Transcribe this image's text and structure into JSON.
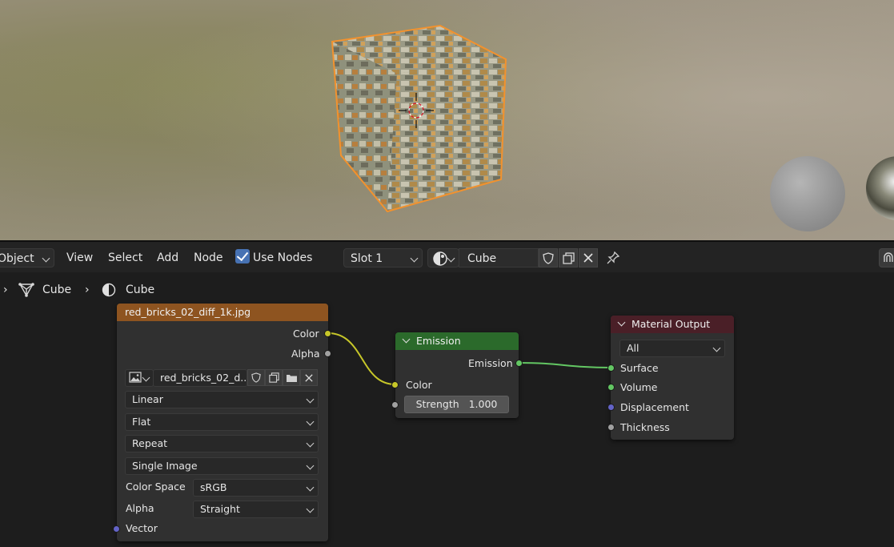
{
  "header": {
    "mode_label": "Object",
    "menu": [
      "View",
      "Select",
      "Add",
      "Node"
    ],
    "use_nodes_label": "Use Nodes",
    "use_nodes_checked": true,
    "slot_label": "Slot 1",
    "material_name": "Cube"
  },
  "breadcrumb": [
    "Cube",
    "Cube"
  ],
  "image_node": {
    "title": "red_bricks_02_diff_1k.jpg",
    "outputs": [
      "Color",
      "Alpha"
    ],
    "image_name": "red_bricks_02_d...",
    "interpolation": "Linear",
    "projection": "Flat",
    "extension": "Repeat",
    "source": "Single Image",
    "color_space_label": "Color Space",
    "color_space": "sRGB",
    "alpha_label": "Alpha",
    "alpha_mode": "Straight",
    "input": "Vector",
    "header_color": "#8e5420"
  },
  "emission_node": {
    "title": "Emission",
    "output": "Emission",
    "color_input": "Color",
    "strength_label": "Strength",
    "strength_value": "1.000",
    "header_color": "#2b6a2b"
  },
  "output_node": {
    "title": "Material Output",
    "target": "All",
    "inputs": [
      "Surface",
      "Volume",
      "Displacement",
      "Thickness"
    ],
    "header_color": "#4a1f27"
  },
  "colors": {
    "link_yellow": "#c7c729",
    "link_green": "#63c763",
    "selection_outline": "#f2922e",
    "checkbox_blue": "#4772b3"
  }
}
